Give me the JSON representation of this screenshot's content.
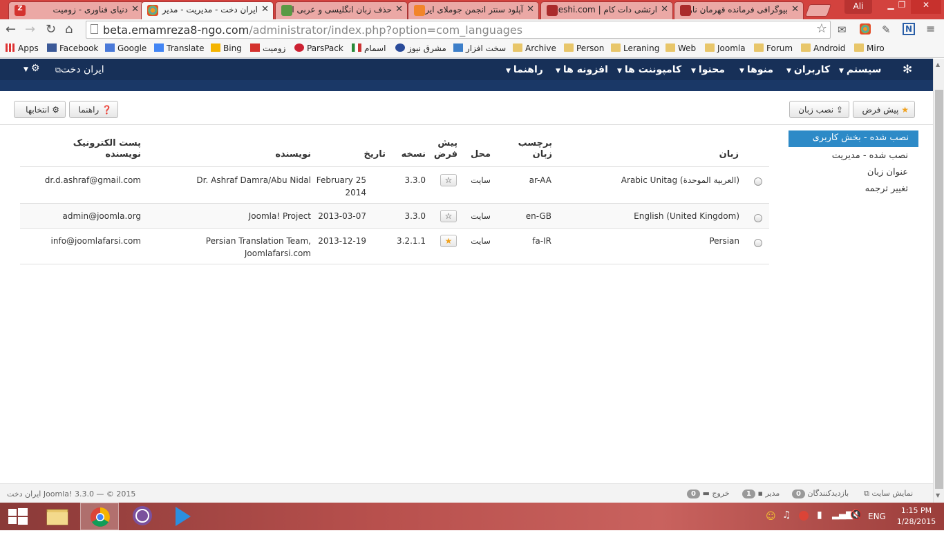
{
  "browser": {
    "tabs": [
      {
        "title": "دنیای فناوری - زومیت",
        "fav": "#d4322e"
      },
      {
        "title": "ایران دخت - مدیریت - مدیر",
        "fav": "#f39b1e"
      },
      {
        "title": "حذف زبان انگلیسی و عربی ا",
        "fav": "#5a9a44"
      },
      {
        "title": "آپلود سنتر انجمن جوملای ایرا",
        "fav": "#f2852a"
      },
      {
        "title": "ارتشی دات کام | rteshi.com",
        "fav": "#aa2b2b"
      },
      {
        "title": "بیوگرافی فرمانده قهرمان ناو",
        "fav": "#aa2b2b"
      }
    ],
    "user": "Ali",
    "url_host": "beta.emamreza8-ngo.com",
    "url_path": "/administrator/index.php?option=com_languages",
    "bookmarks": [
      {
        "label": "Apps",
        "icon": "apps-icon"
      },
      {
        "label": "Facebook",
        "icon": "facebook-icon"
      },
      {
        "label": "Google",
        "icon": "google-icon"
      },
      {
        "label": "Translate",
        "icon": "translate-icon"
      },
      {
        "label": "Bing",
        "icon": "bing-icon"
      },
      {
        "label": "زومیت",
        "icon": "zoomit-icon"
      },
      {
        "label": "ParsPack",
        "icon": "parspack-icon"
      },
      {
        "label": "اسمام",
        "icon": "esmam-icon"
      },
      {
        "label": "مشرق نیوز",
        "icon": "mashregh-icon"
      },
      {
        "label": "سخت افزار",
        "icon": "hardware-icon"
      },
      {
        "label": "Archive",
        "icon": "folder-icon"
      },
      {
        "label": "Person",
        "icon": "folder-icon"
      },
      {
        "label": "Leraning",
        "icon": "folder-icon"
      },
      {
        "label": "Web",
        "icon": "folder-icon"
      },
      {
        "label": "Joomla",
        "icon": "folder-icon"
      },
      {
        "label": "Forum",
        "icon": "folder-icon"
      },
      {
        "label": "Android",
        "icon": "folder-icon"
      },
      {
        "label": "Miro",
        "icon": "folder-icon"
      }
    ]
  },
  "joomla": {
    "site_link": "ایران دخت",
    "menu": [
      "سیستم",
      "کاربران",
      "منوها",
      "محتوا",
      "کامپوننت ها",
      "افزونه ها",
      "راهنما"
    ],
    "toolbar": {
      "default": "پیش فرض",
      "install": "نصب زبان",
      "help": "راهنما",
      "options": "انتخابها"
    },
    "sidebar": {
      "active": "نصب شده - بخش کاربری",
      "items": [
        "نصب شده - مدیریت",
        "عنوان زبان",
        "تغییر ترجمه"
      ]
    },
    "table": {
      "headers": {
        "language": "زبان",
        "tag": [
          "برچسب",
          "زبان"
        ],
        "location": "محل",
        "default": [
          "پیش",
          "فرض"
        ],
        "version": "نسخه",
        "date": "تاریخ",
        "author": "نویسنده",
        "email": [
          "پست الکترونیک",
          "نویسنده"
        ]
      },
      "rows": [
        {
          "language": "Arabic Unitag (العربية الموحدة)",
          "tag": "ar-AA",
          "location": "سایت",
          "is_default": false,
          "version": "3.3.0",
          "date": [
            "February 25",
            "2014"
          ],
          "author": [
            "Dr. Ashraf Damra/Abu Nidal"
          ],
          "email": "dr.d.ashraf@gmail.com"
        },
        {
          "language": "English (United Kingdom)",
          "tag": "en-GB",
          "location": "سایت",
          "is_default": false,
          "version": "3.3.0",
          "date": [
            "2013-03-07"
          ],
          "author": [
            "Joomla! Project"
          ],
          "email": "admin@joomla.org"
        },
        {
          "language": "Persian",
          "tag": "fa-IR",
          "location": "سایت",
          "is_default": true,
          "version": "3.2.1.1",
          "date": [
            "2013-12-19"
          ],
          "author": [
            "Persian Translation Team,",
            "Joomlafarsi.com"
          ],
          "email": "info@joomlafarsi.com"
        }
      ]
    },
    "footer": {
      "view_site": "نمایش سایت",
      "visitors_count": "0",
      "visitors": "بازدیدکنندگان",
      "admins_count": "1",
      "admins": "مدیر",
      "logout_count": "0",
      "logout": "خروج",
      "copyright": "ایران دخت Joomla! 3.3.0 — © 2015"
    }
  },
  "taskbar": {
    "lang": "ENG",
    "time": "1:15 PM",
    "date": "1/28/2015"
  },
  "colors": {
    "chrome_frame": "#d3423e",
    "joomla_nav": "#173058",
    "active_blue": "#2d8ac7",
    "star": "#f0a11d"
  }
}
